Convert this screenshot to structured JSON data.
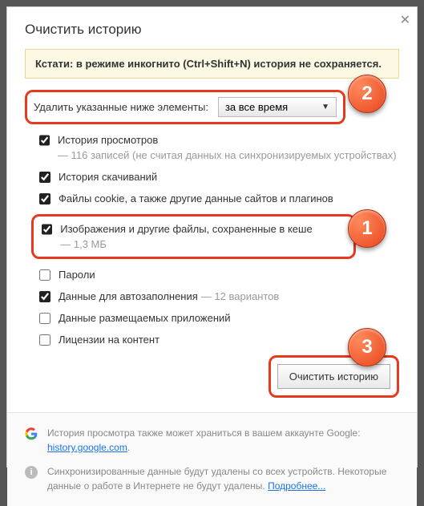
{
  "title": "Очистить историю",
  "tip": "Кстати: в режиме инкогнито (Ctrl+Shift+N) история не сохраняется.",
  "range": {
    "label": "Удалить указанные ниже элементы:",
    "selected": "за все время"
  },
  "options": {
    "browsing": {
      "label": "История просмотров",
      "detail": "— 116 записей (не считая данных на синхронизируемых устройствах)",
      "checked": true
    },
    "downloads": {
      "label": "История скачиваний",
      "checked": true
    },
    "cookies": {
      "label": "Файлы cookie, а также другие данные сайтов и плагинов",
      "checked": true
    },
    "cache": {
      "label": "Изображения и другие файлы, сохраненные в кеше",
      "detail": "— 1,3 МБ",
      "checked": true
    },
    "passwords": {
      "label": "Пароли",
      "checked": false
    },
    "autofill": {
      "label": "Данные для автозаполнения",
      "detail": "— 12 вариантов",
      "checked": true
    },
    "hosted": {
      "label": "Данные размещаемых приложений",
      "checked": false
    },
    "licenses": {
      "label": "Лицензии на контент",
      "checked": false
    }
  },
  "clearButton": "Очистить историю",
  "footer": {
    "google1": "История просмотра также может храниться в вашем аккаунте Google:",
    "googleLink": "history.google.com",
    "sync": "Синхронизированные данные будут удалены со всех устройств. Некоторые данные о работе в Интернете не будут удалены.",
    "more": "Подробнее..."
  },
  "badges": {
    "b1": "1",
    "b2": "2",
    "b3": "3"
  }
}
